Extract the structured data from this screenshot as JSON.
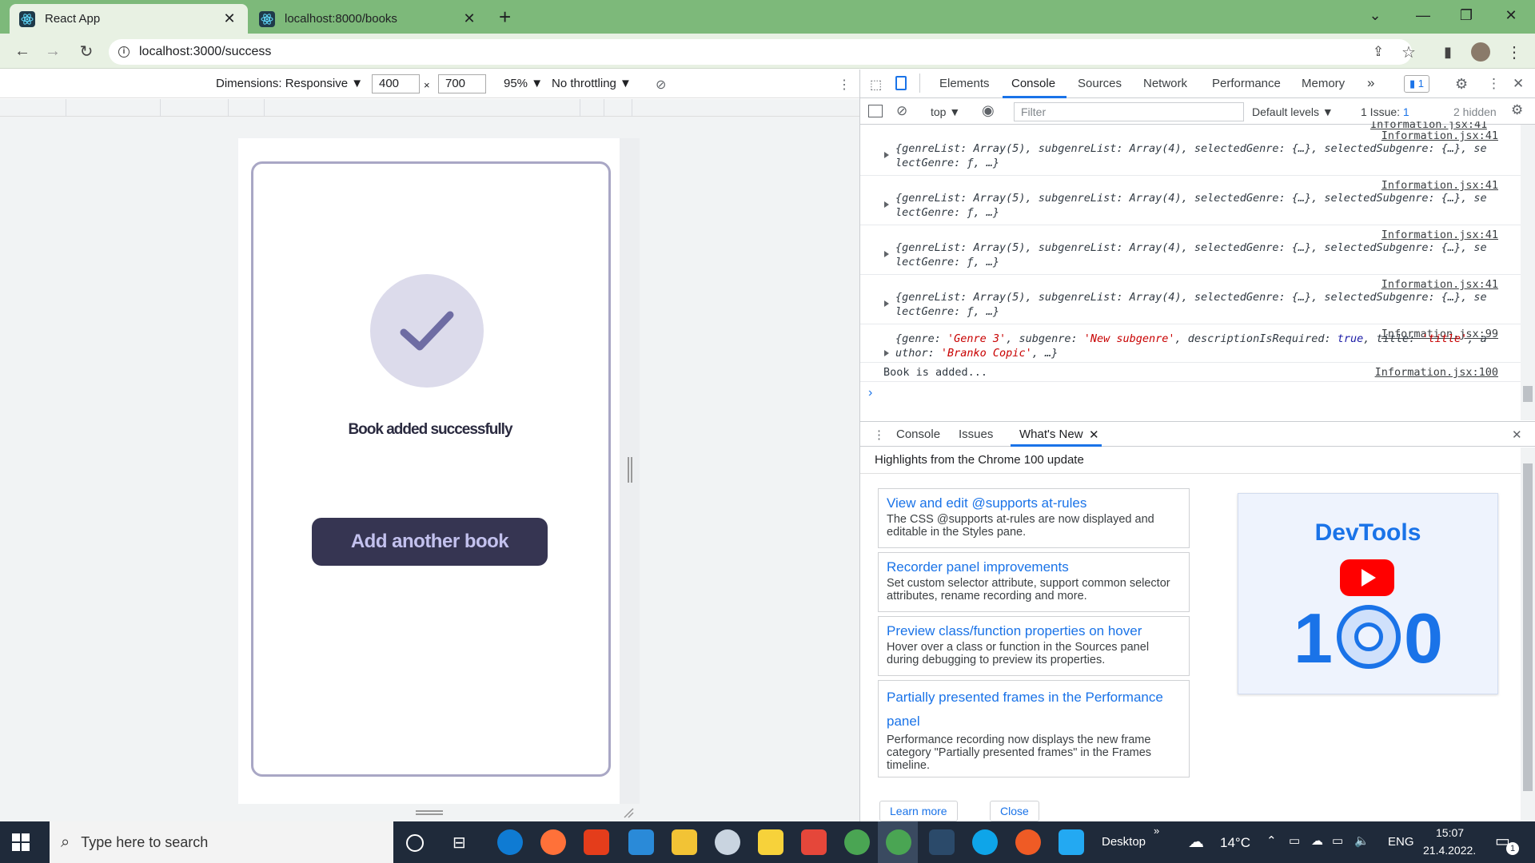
{
  "browser": {
    "tabs": [
      {
        "title": "React App",
        "active": true
      },
      {
        "title": "localhost:8000/books",
        "active": false
      }
    ],
    "url": "localhost:3000/success"
  },
  "device_toolbar": {
    "dimensions_label": "Dimensions: Responsive ▼",
    "width": "400",
    "times": "×",
    "height": "700",
    "zoom": "95% ▼",
    "throttling": "No throttling ▼"
  },
  "app": {
    "success_message": "Book added successfully",
    "add_button": "Add another book"
  },
  "devtools": {
    "tabs": [
      "Elements",
      "Console",
      "Sources",
      "Network",
      "Performance",
      "Memory"
    ],
    "active_tab": "Console",
    "more": "»",
    "issue_badge": "1",
    "console_toolbar": {
      "context": "top ▼",
      "filter_placeholder": "Filter",
      "levels": "Default levels ▼",
      "issues": "1 Issue:",
      "issues_count": "1",
      "hidden": "2 hidden"
    },
    "logs": [
      {
        "src": "Information.jsx:41",
        "l1": "{genreList: Array(5), subgenreList: Array(4), selectedGenre: {…}, selectedSubgenre: {…}, se",
        "l2": "lectGenre: ƒ, …}"
      },
      {
        "src": "Information.jsx:41",
        "l1": "{genreList: Array(5), subgenreList: Array(4), selectedGenre: {…}, selectedSubgenre: {…}, se",
        "l2": "lectGenre: ƒ, …}"
      },
      {
        "src": "Information.jsx:41",
        "l1": "{genreList: Array(5), subgenreList: Array(4), selectedGenre: {…}, selectedSubgenre: {…}, se",
        "l2": "lectGenre: ƒ, …}"
      },
      {
        "src": "Information.jsx:41",
        "l1": "{genreList: Array(5), subgenreList: Array(4), selectedGenre: {…}, selectedSubgenre: {…}, se",
        "l2": "lectGenre: ƒ, …}"
      }
    ],
    "log_top_partial": "Information.jsx:41",
    "log_object": {
      "src": "Information.jsx:99",
      "p1": "{genre: ",
      "v1": "'Genre 3'",
      "p2": ", subgenre: ",
      "v2": "'New subgenre'",
      "p3": ", descriptionIsRequired: ",
      "v3": "true",
      "p4": ", title: ",
      "v4": "'title'",
      "p5": ", a",
      "p6": "uthor: ",
      "v6": "'Branko Copic'",
      "p7": ", …}"
    },
    "log_text": {
      "text": "Book is added...",
      "src": "Information.jsx:100"
    },
    "prompt": "›",
    "drawer": {
      "tabs": [
        "Console",
        "Issues",
        "What's New"
      ],
      "active": "What's New",
      "highlights": "Highlights from the Chrome 100 update",
      "features": [
        {
          "title": "View and edit @supports at-rules",
          "desc": "The CSS @supports at-rules are now displayed and editable in the Styles pane."
        },
        {
          "title": "Recorder panel improvements",
          "desc": "Set custom selector attribute, support common selector attributes, rename recording and more."
        },
        {
          "title": "Preview class/function properties on hover",
          "desc": "Hover over a class or function in the Sources panel during debugging to preview its properties."
        },
        {
          "title": "Partially presented frames in the Performance panel",
          "desc": "Performance recording now displays the new frame category \"Partially presented frames\" in the Frames timeline."
        }
      ],
      "promo_title": "DevTools",
      "promo_digit_1": "1",
      "promo_digit_0": "0",
      "learn_more": "Learn more",
      "close": "Close"
    }
  },
  "taskbar": {
    "search_placeholder": "Type here to search",
    "desktop": "Desktop",
    "chevron": "»",
    "temperature": "14°C",
    "language": "ENG",
    "time": "15:07",
    "date": "21.4.2022.",
    "notification_count": "1"
  },
  "colors": {
    "tabbar": "#7db97a",
    "button_bg": "#363552",
    "button_text": "#c3c1ee",
    "check": "#6e6ca3",
    "accent": "#1a73e8"
  }
}
